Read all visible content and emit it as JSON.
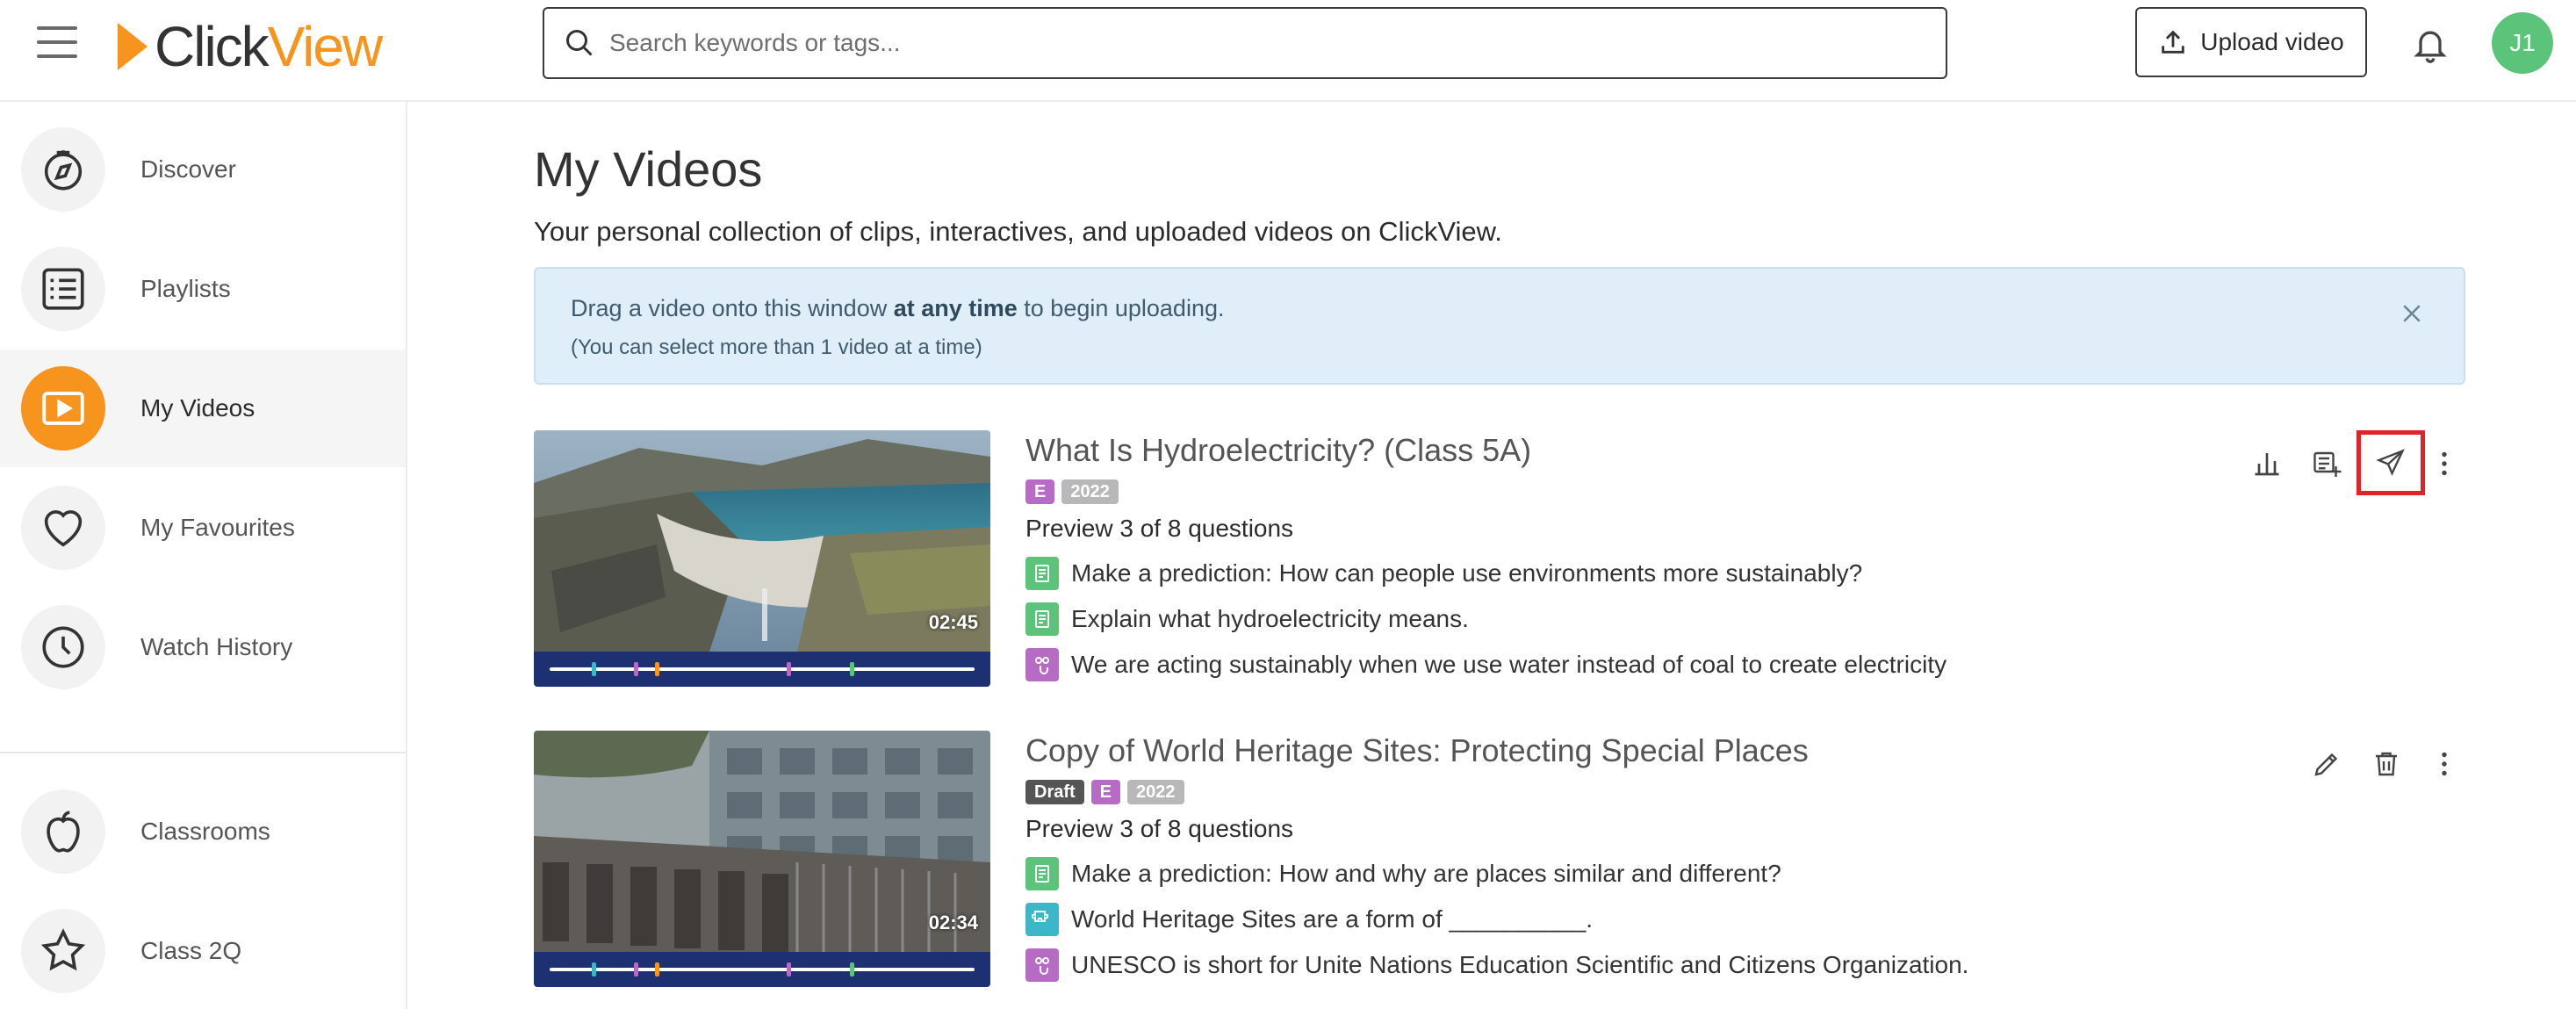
{
  "header": {
    "logo_click": "Click",
    "logo_view": "View",
    "search_placeholder": "Search keywords or tags...",
    "upload_label": "Upload video",
    "avatar_initials": "J1"
  },
  "sidebar": {
    "items": [
      {
        "label": "Discover",
        "icon": "compass-icon"
      },
      {
        "label": "Playlists",
        "icon": "list-icon"
      },
      {
        "label": "My Videos",
        "icon": "play-icon",
        "active": true
      },
      {
        "label": "My Favourites",
        "icon": "heart-icon"
      },
      {
        "label": "Watch History",
        "icon": "clock-icon"
      },
      {
        "label": "Classrooms",
        "icon": "apple-icon"
      },
      {
        "label": "Class 2Q",
        "icon": "star-icon"
      }
    ]
  },
  "main": {
    "title": "My Videos",
    "subtitle": "Your personal collection of clips, interactives, and uploaded videos on ClickView.",
    "banner": {
      "line1_pre": "Drag a video onto this window ",
      "line1_bold": "at any time",
      "line1_post": " to begin uploading.",
      "line2": "(You can select more than 1 video at a time)"
    },
    "videos": [
      {
        "title": "What Is Hydroelectricity? (Class 5A)",
        "badges": [
          "E",
          "2022"
        ],
        "duration": "02:45",
        "preview": "Preview 3 of 8 questions",
        "questions": [
          {
            "text": "Make a prediction: How can people use environments more sustainably?",
            "type": "text"
          },
          {
            "text": "Explain what hydroelectricity means.",
            "type": "text"
          },
          {
            "text": "We are acting sustainably when we use water instead of coal to create electricity",
            "type": "truefalse"
          }
        ]
      },
      {
        "title": "Copy of World Heritage Sites: Protecting Special Places",
        "badges": [
          "Draft",
          "E",
          "2022"
        ],
        "duration": "02:34",
        "preview": "Preview 3 of 8 questions",
        "questions": [
          {
            "text": "Make a prediction: How and why are places similar and different?",
            "type": "text"
          },
          {
            "text": "World Heritage Sites are a form of __________.",
            "type": "fillblank"
          },
          {
            "text": "UNESCO is short for Unite Nations Education Scientific and Citizens Organization.",
            "type": "truefalse"
          }
        ]
      }
    ]
  },
  "colors": {
    "brand_orange": "#f7941d",
    "avatar_green": "#5bc47a",
    "badge_purple": "#b66cc4",
    "highlight_red": "#e0232b",
    "q_green": "#5bc47a",
    "q_teal": "#3bb7c9",
    "q_purple": "#b66cc4"
  }
}
